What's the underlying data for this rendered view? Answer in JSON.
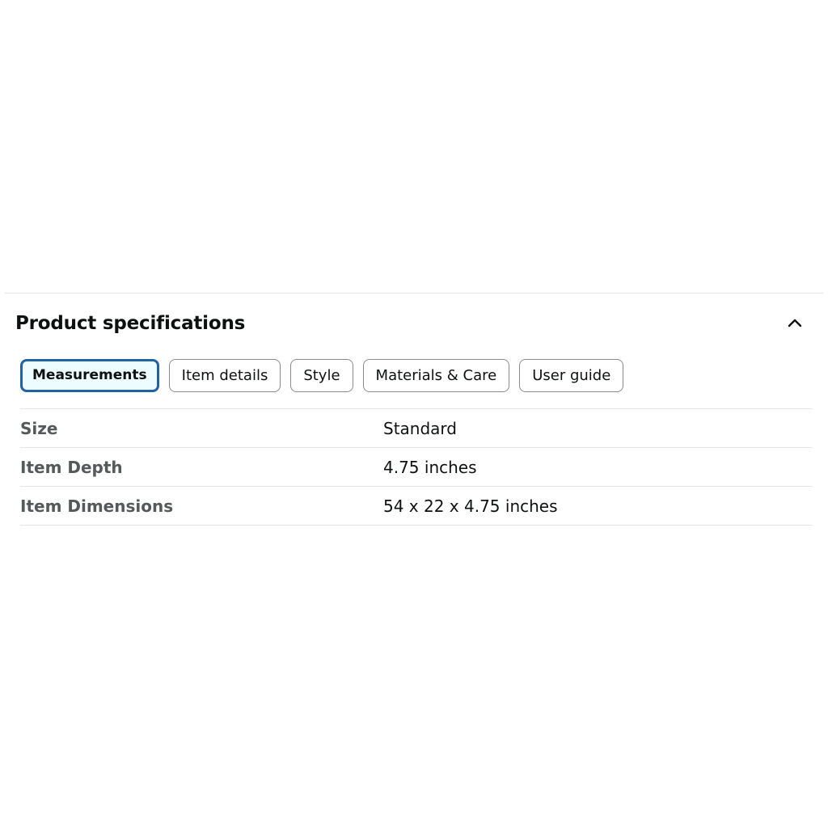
{
  "section": {
    "title": "Product specifications",
    "toggle_icon": "chevron-up-icon"
  },
  "tabs": [
    {
      "label": "Measurements",
      "active": true
    },
    {
      "label": "Item details",
      "active": false
    },
    {
      "label": "Style",
      "active": false
    },
    {
      "label": "Materials & Care",
      "active": false
    },
    {
      "label": "User guide",
      "active": false
    }
  ],
  "specs": [
    {
      "label": "Size",
      "value": "Standard"
    },
    {
      "label": "Item Depth",
      "value": "4.75 inches"
    },
    {
      "label": "Item Dimensions",
      "value": "54 x 22 x 4.75 inches"
    }
  ],
  "colors": {
    "active_tab_border": "#2162a1",
    "active_tab_background": "#edfdff",
    "label_text": "#565959",
    "divider": "#e3e6e6"
  }
}
